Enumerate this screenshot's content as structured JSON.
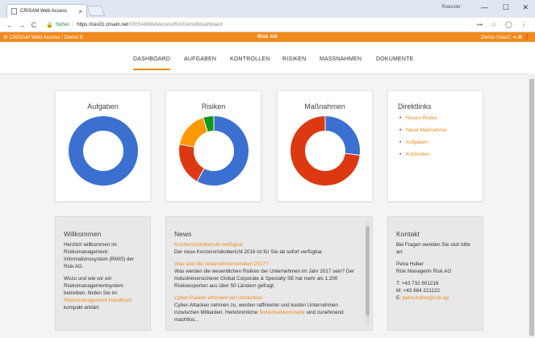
{
  "browser": {
    "tab_title": "CRISAM Web Access",
    "tab_close": "×",
    "window_user": "Roessler",
    "window_controls": [
      "—",
      "☐",
      "✕"
    ],
    "back": "←",
    "forward": "→",
    "reload": "C",
    "secure_label": "Sicher",
    "url_host": "https://ces01.crisam.net",
    "url_path": "/CRISAMWebAccessR/#/Demo8/dashboard",
    "addr_icons": "⊶ ☆ ◯ ⋮"
  },
  "appbar": {
    "breadcrumb": "⚙ CRISAM Web Access / Demo 8",
    "brand": "Risk AG",
    "user": "Demo User2 ⇥  ✿  ❓"
  },
  "nav": {
    "items": [
      "DASHBOARD",
      "AUFGABEN",
      "KONTROLLEN",
      "RISIKEN",
      "MASSNAHMEN",
      "DOKUMENTE"
    ],
    "active": "DASHBOARD"
  },
  "cards": {
    "aufgaben_title": "Aufgaben",
    "risiken_title": "Risiken",
    "massnahmen_title": "Maßnahmen",
    "direktlinks_title": "Direktlinks",
    "direktlinks": [
      "Neues Risiko",
      "Neue Maßnahme",
      "Aufgaben",
      "Kontrollen"
    ]
  },
  "colors": {
    "accent": "#f08a1c",
    "blue": "#3b6fd0",
    "red": "#dc3912",
    "orange": "#ff9900",
    "green": "#109618"
  },
  "donuts": {
    "aufgaben": [
      {
        "value": 100,
        "color": "#3b6fd0"
      }
    ],
    "risiken": [
      {
        "value": 58,
        "color": "#3b6fd0"
      },
      {
        "value": 20,
        "color": "#dc3912"
      },
      {
        "value": 17,
        "color": "#ff9900"
      },
      {
        "value": 5,
        "color": "#109618"
      }
    ],
    "massnahmen": [
      {
        "value": 27,
        "color": "#3b6fd0"
      },
      {
        "value": 73,
        "color": "#dc3912"
      }
    ]
  },
  "willkommen": {
    "title": "Willkommen",
    "p1": "Herzlich willkommen im Risikomanagement-Informationssystem (RMIS) der Risk AG.",
    "p2_pre": "Wozu und wie wir ein Risikomanagementsystem betreiben, finden Sie im ",
    "p2_link": "Risikomanagement Handbuch",
    "p2_post": " kompakt erklärt."
  },
  "news": {
    "title": "News",
    "items": [
      {
        "head": "Konzernrisikobericht verfügbar",
        "text": "Der neue Konzernrisikobericht 2016 ist für Sie ab sofort verfügbar."
      },
      {
        "head": "Was sind die Unternehmensrisiken 2017?",
        "text": "Was werden die wesentlichen Risiken der Unternehmen im Jahr 2017 sein? Der Industrieversicherer Global Corporate & Specialty SE hat mehr als 1.200 Risikoexperten aus über 50 Ländern gefragt."
      },
      {
        "head": "Cyber-Risiken erfordern ein Umdenken",
        "text_pre": "Cyber-Attacken nehmen zu, werden raffinierter und kosten Unternehmen inzwischen Milliarden. Herkömmliche ",
        "text_link": "Sicherheitskonzepte",
        "text_post": " sind zunehmend machtlos..."
      }
    ]
  },
  "kontakt": {
    "title": "Kontakt",
    "intro": "Bei Fragen wenden Sie sich bitte an:",
    "name": "Petra Huber",
    "role": "Risk Managerin Risk AG",
    "phone": "T: +43 732 601216",
    "mobile": "M: +43 664 221122",
    "email_label": "E: ",
    "email": "petra.huber@risk.ag"
  }
}
